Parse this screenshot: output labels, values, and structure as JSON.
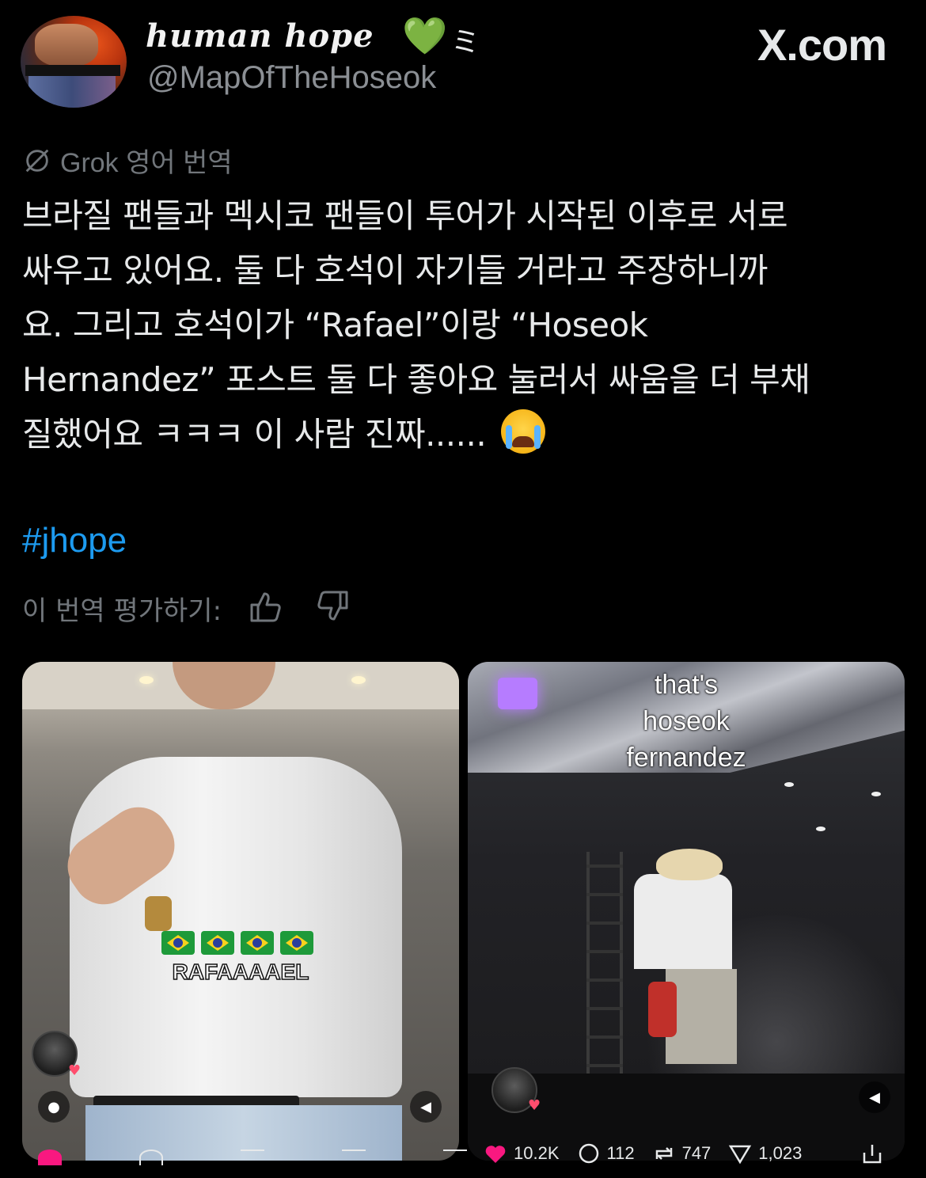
{
  "profile": {
    "display_name": "human hope",
    "name_emoji": "💚",
    "name_suffix": "ミ",
    "handle": "@MapOfTheHoseok"
  },
  "brand": {
    "site": "X.com"
  },
  "translation_notice": "Grok 영어 번역",
  "tweet": {
    "line1": "브라질 팬들과 멕시코 팬들이 투어가 시작된 이후로 서로",
    "line2": "싸우고 있어요. 둘 다 호석이 자기들 거라고 주장하니까",
    "line3": "요. 그리고 호석이가 “Rafael”이랑 “Hoseok",
    "line4": "Hernandez” 포스트 둘 다 좋아요 눌러서 싸움을 더 부채",
    "line5": "질했어요 ㅋㅋㅋ 이 사람 진짜......",
    "hashtag": "#jhope"
  },
  "rate_translation": {
    "label": "이 번역 평가하기:"
  },
  "media": {
    "left": {
      "caption": "RAFAAAAEL",
      "flags": [
        "brazil-flag",
        "brazil-flag",
        "brazil-flag",
        "brazil-flag"
      ]
    },
    "right": {
      "caption_line1": "that's",
      "caption_line2": "hoseok",
      "caption_line3": "fernandez"
    }
  },
  "stats": {
    "likes": "10.2K",
    "comments": "112",
    "reposts": "747",
    "saves": "1,023"
  },
  "colors": {
    "background": "#000000",
    "text": "#e7e9ea",
    "muted": "#71767b",
    "link": "#1d9bf0",
    "heart": "#4fd34c",
    "like": "#f91880"
  }
}
